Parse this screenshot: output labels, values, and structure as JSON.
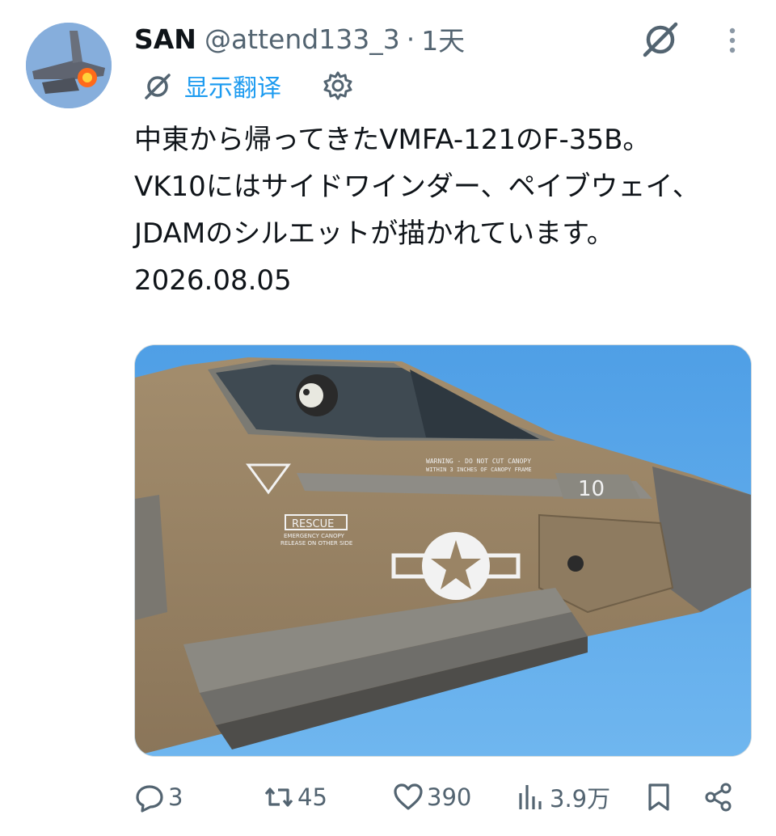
{
  "tweet": {
    "author_name": "SAN",
    "author_handle": "@attend133_3",
    "separator": "·",
    "time": "1天",
    "translate_label": "显示翻译",
    "text_lines": [
      "中東から帰ってきたVMFA-121のF-35B。",
      "VK10にはサイドワインダー、ペイブウェイ、JDAMのシルエットが描かれています。",
      "2026.08.05"
    ]
  },
  "media": {
    "aircraft_number": "10",
    "rescue_label": "RESCUE",
    "rescue_sub": "EMERGENCY CANOPY",
    "rescue_sub2": "RELEASE ON OTHER SIDE",
    "warning_line1": "WARNING - DO NOT CUT CANOPY",
    "warning_line2": "WITHIN 3 INCHES OF CANOPY FRAME"
  },
  "actions": {
    "replies": "3",
    "retweets": "45",
    "likes": "390",
    "views": "3.9万"
  },
  "icons": {
    "grok": "grok-icon",
    "more": "more-vertical-icon",
    "translate": "translate-icon",
    "settings": "gear-icon",
    "reply": "reply-icon",
    "retweet": "retweet-icon",
    "like": "heart-icon",
    "views": "views-icon",
    "bookmark": "bookmark-icon",
    "share": "share-icon"
  },
  "colors": {
    "link": "#1d9bf0",
    "secondary_text": "#536471",
    "sky": "#5aa7e8",
    "aircraft_tan": "#9a8465"
  }
}
